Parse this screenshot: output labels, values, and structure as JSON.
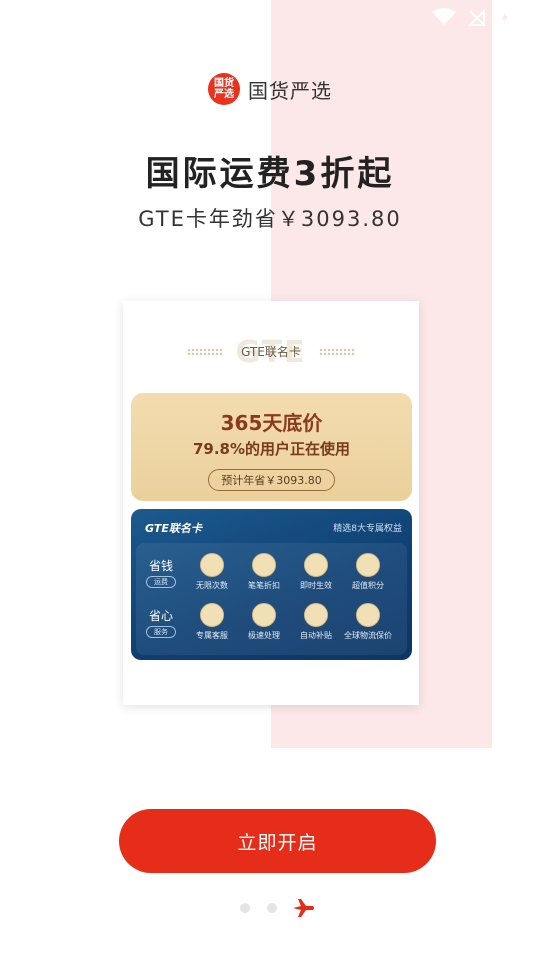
{
  "status_bar": {
    "battery_level": "4"
  },
  "brand": {
    "logo_text": "国货\n严选",
    "name": "国货严选"
  },
  "headline": "国际运费3折起",
  "subline": "GTE卡年劲省￥3093.80",
  "card": {
    "ghost_text": "GTE",
    "name": "GTE联名卡",
    "gold": {
      "days": "365天底价",
      "usage": "79.8%的用户正在使用",
      "estimate": "预计年省￥3093.80"
    },
    "blue": {
      "title": "GTE联名卡",
      "rights": "精选8大专属权益",
      "rows": [
        {
          "label": "省钱",
          "tag": "运费",
          "features": [
            "无限次数",
            "笔笔折扣",
            "即时生效",
            "超值积分"
          ]
        },
        {
          "label": "省心",
          "tag": "服务",
          "features": [
            "专属客服",
            "极速处理",
            "自动补贴",
            "全球物流保价"
          ]
        }
      ]
    }
  },
  "cta": {
    "label": "立即开启"
  },
  "pager": {
    "count": 3,
    "active_index": 2
  },
  "colors": {
    "accent": "#e52d1a",
    "pink_panel": "#fde8e9"
  }
}
